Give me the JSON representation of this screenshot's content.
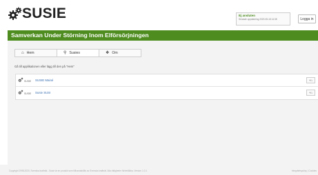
{
  "header": {
    "logo_text": "SUSIE",
    "status_title": "Ej ansluten",
    "status_sub": "Senaste uppdatering 2020-05-18 14:38",
    "login_label": "Logga in"
  },
  "titlebar": {
    "title": "Samverkan Under Störning Inom Elförsörjningen"
  },
  "tabs": [
    {
      "label": "Hem",
      "icon": "home-icon"
    },
    {
      "label": "Susies",
      "icon": "search-icon"
    },
    {
      "label": "Om",
      "icon": "info-icon"
    }
  ],
  "intro": "Gå till applikationen eller lägg till den på \"Hem\"",
  "list": [
    {
      "logo_text": "SUSIE",
      "link": "SUSIE Mainé"
    },
    {
      "logo_text": "SUSIE",
      "link": "Susie SUSI"
    }
  ],
  "footer": {
    "left": "Copyright 1998-2020, Svenska kraftnät - Susie är en produkt som tillhandahålls av Svenska kraftnät. Alla rättigheter förbehållna. Version 1.0.1",
    "right": "Integritetspolicy | Cookies"
  },
  "colors": {
    "brand_green": "#4e8c1f",
    "status_green": "#4a8a1c",
    "link_blue": "#3a6fb0"
  }
}
